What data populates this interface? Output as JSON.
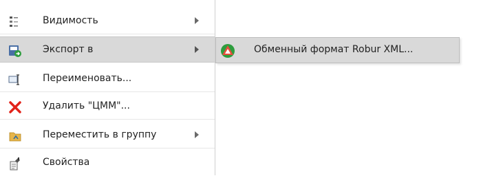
{
  "menu": {
    "items": [
      {
        "label": "Видимость",
        "icon": "visibility-tree-icon",
        "has_submenu": true
      },
      {
        "label": "Экспорт в",
        "icon": "export-icon",
        "has_submenu": true,
        "active": true
      },
      {
        "label": "Переименовать...",
        "icon": "rename-icon",
        "has_submenu": false
      },
      {
        "label": "Удалить \"ЦММ\"...",
        "icon": "delete-x-icon",
        "has_submenu": false
      },
      {
        "label": "Переместить в группу",
        "icon": "move-to-group-folder-icon",
        "has_submenu": true
      },
      {
        "label": "Свойства",
        "icon": "properties-icon",
        "has_submenu": false
      }
    ]
  },
  "submenu": {
    "items": [
      {
        "label": "Обменный формат Robur XML...",
        "icon": "robur-logo-icon"
      }
    ]
  },
  "colors": {
    "active_bg": "#d9d9d9",
    "delete_red": "#e2231a",
    "export_blue": "#4a6fa5",
    "robur_red": "#e74c3c",
    "robur_green": "#2e9d3e"
  }
}
